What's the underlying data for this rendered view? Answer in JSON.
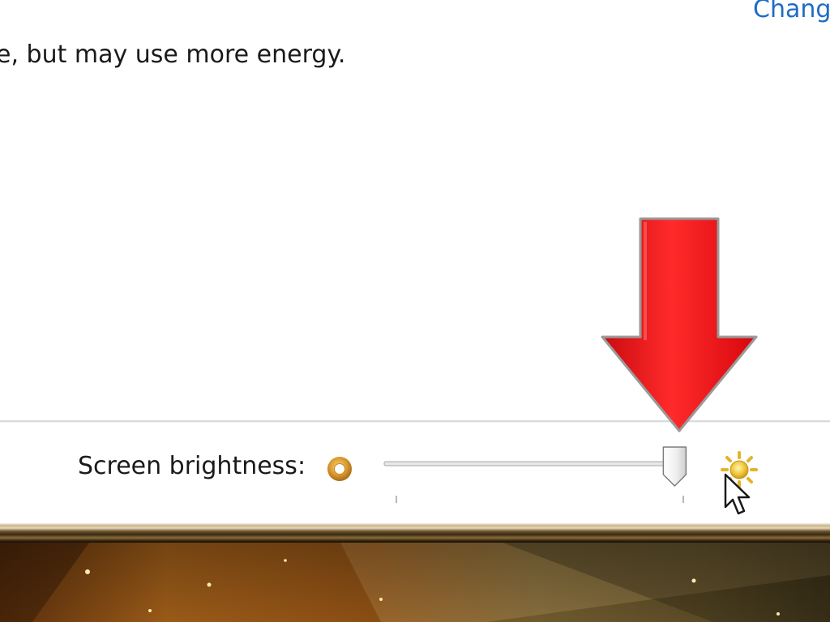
{
  "header": {
    "link_label": "Chang"
  },
  "plan": {
    "description": "e, but may use more energy."
  },
  "brightness": {
    "label": "Screen brightness:",
    "level_fraction": 0.97,
    "dim_icon": "dim-sun-icon",
    "bright_icon": "bright-sun-icon"
  },
  "annotation": {
    "icon": "red-down-arrow-icon",
    "color": "#e8141a"
  },
  "colors": {
    "link": "#1e6cc8",
    "text": "#1a1a1a",
    "divider": "#d9d9d9"
  }
}
